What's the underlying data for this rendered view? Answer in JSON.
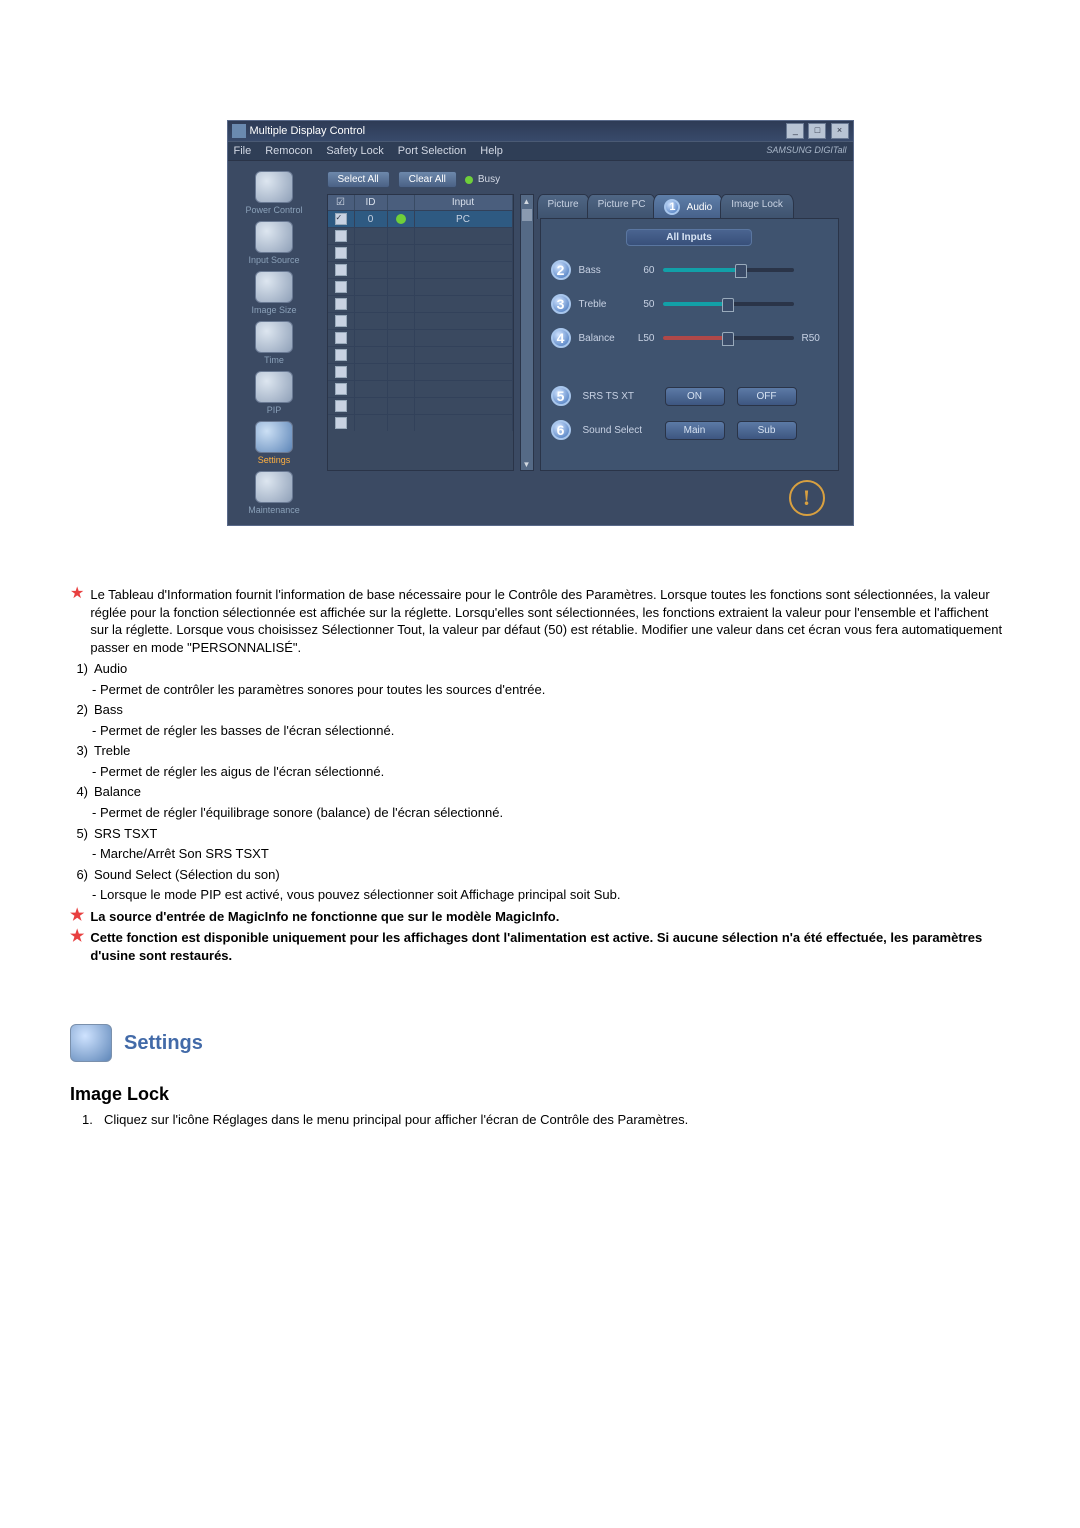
{
  "app": {
    "title": "Multiple Display Control",
    "brand": "SAMSUNG DIGITall",
    "menu": [
      "File",
      "Remocon",
      "Safety Lock",
      "Port Selection",
      "Help"
    ],
    "toolbar": {
      "select_all": "Select All",
      "clear_all": "Clear All",
      "busy": "Busy"
    },
    "sidebar": [
      {
        "label": "Power Control"
      },
      {
        "label": "Input Source"
      },
      {
        "label": "Image Size"
      },
      {
        "label": "Time"
      },
      {
        "label": "PIP"
      },
      {
        "label": "Settings"
      },
      {
        "label": "Maintenance"
      }
    ],
    "grid": {
      "headers": {
        "id": "ID",
        "input": "Input"
      },
      "row0": {
        "id": "0",
        "input": "PC"
      }
    },
    "tabs": [
      {
        "label": "Picture"
      },
      {
        "label": "Picture PC"
      },
      {
        "label": "Audio"
      },
      {
        "label": "Image Lock"
      }
    ],
    "active_tab_badge": "1",
    "panel": {
      "inputs_label": "All Inputs",
      "sliders": [
        {
          "num": "2",
          "label": "Bass",
          "left": "60",
          "value": 60,
          "max": 100
        },
        {
          "num": "3",
          "label": "Treble",
          "left": "50",
          "value": 50,
          "max": 100
        },
        {
          "num": "4",
          "label": "Balance",
          "left": "L50",
          "right": "R50",
          "value": 50,
          "max": 100
        }
      ],
      "buttons": [
        {
          "num": "5",
          "label": "SRS TS XT",
          "b1": "ON",
          "b2": "OFF"
        },
        {
          "num": "6",
          "label": "Sound Select",
          "b1": "Main",
          "b2": "Sub"
        }
      ]
    }
  },
  "doc": {
    "intro": "Le Tableau d'Information fournit l'information de base nécessaire pour le Contrôle des Paramètres. Lorsque toutes les fonctions sont sélectionnées, la valeur réglée pour la fonction sélectionnée est affichée sur la réglette. Lorsqu'elles sont sélectionnées, les fonctions extraient la valeur pour l'ensemble et l'affichent sur la réglette. Lorsque vous choisissez Sélectionner Tout, la valeur par défaut (50) est rétablie. Modifier une valeur dans cet écran vous fera automatiquement passer en mode \"PERSONNALISÉ\".",
    "items": [
      {
        "n": "1)",
        "t": "Audio",
        "d": "- Permet de contrôler les paramètres sonores pour toutes les sources d'entrée."
      },
      {
        "n": "2)",
        "t": "Bass",
        "d": "- Permet de régler les basses de l'écran sélectionné."
      },
      {
        "n": "3)",
        "t": "Treble",
        "d": "- Permet de régler les aigus de l'écran sélectionné."
      },
      {
        "n": "4)",
        "t": "Balance",
        "d": "- Permet de régler l'équilibrage sonore (balance) de l'écran sélectionné."
      },
      {
        "n": "5)",
        "t": "SRS TSXT",
        "d": "- Marche/Arrêt Son SRS TSXT"
      },
      {
        "n": "6)",
        "t": "Sound Select (Sélection du son)",
        "d": "- Lorsque le mode PIP est activé, vous pouvez sélectionner soit Affichage principal soit Sub."
      }
    ],
    "note1": "La source d'entrée de MagicInfo ne fonctionne que sur le modèle MagicInfo.",
    "note2": "Cette fonction est disponible uniquement pour les affichages dont l'alimentation est active. Si aucune sélection n'a été effectuée, les paramètres d'usine sont restaurés.",
    "section": "Settings",
    "h3": "Image Lock",
    "step1_n": "1.",
    "step1": "Cliquez sur l'icône Réglages dans le menu principal pour afficher l'écran de Contrôle des Paramètres."
  }
}
